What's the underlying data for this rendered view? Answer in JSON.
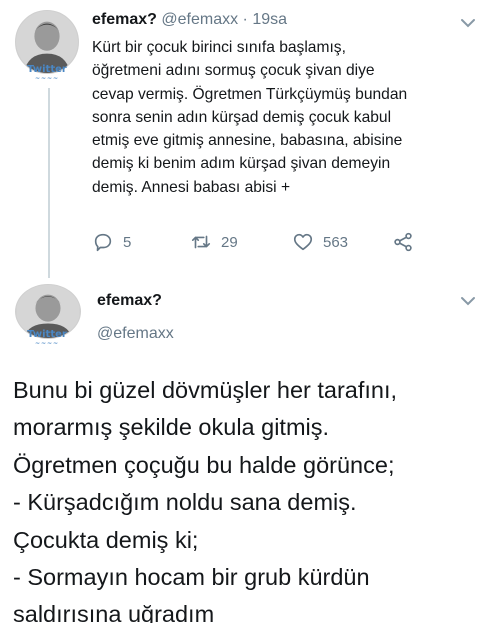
{
  "tweet1": {
    "name": "efemax?",
    "handle": "@efemaxx",
    "separator": "·",
    "time": "19sa",
    "avatar_watermark": "Twitter",
    "body_lines": [
      "Kürt bir çocuk birinci sınıfa başlamış,",
      "öğretmeni adını sormuş çocuk şivan diye",
      "cevap vermiş. Ögretmen Türkçüymüş bundan",
      "sonra senin adın kürşad demiş çocuk kabul",
      "etmiş eve gitmiş annesine, babasına, abisine",
      "demiş ki benim adım kürşad şivan demeyin",
      "demiş. Annesi babası abisi +"
    ],
    "actions": {
      "reply_count": "5",
      "retweet_count": "29",
      "like_count": "563"
    }
  },
  "tweet2": {
    "name": "efemax?",
    "handle": "@efemaxx",
    "avatar_watermark": "Twitter",
    "body_lines": [
      "Bunu bi güzel dövmüşler her tarafını,",
      "morarmış şekilde okula gitmiş.",
      "Ögretmen çoçuğu bu halde görünce;",
      "- Kürşadcığım noldu sana demiş.",
      "Çocukta demiş ki;",
      "- Sormayın hocam bir grub kürdün",
      "saldırısına uğradım"
    ]
  },
  "colors": {
    "text": "#14171a",
    "secondary": "#657786",
    "thread_line": "#cfd9de",
    "watermark": "#4a87c4"
  },
  "icons": [
    "chevron-down-icon",
    "reply-icon",
    "retweet-icon",
    "like-icon",
    "share-icon"
  ]
}
